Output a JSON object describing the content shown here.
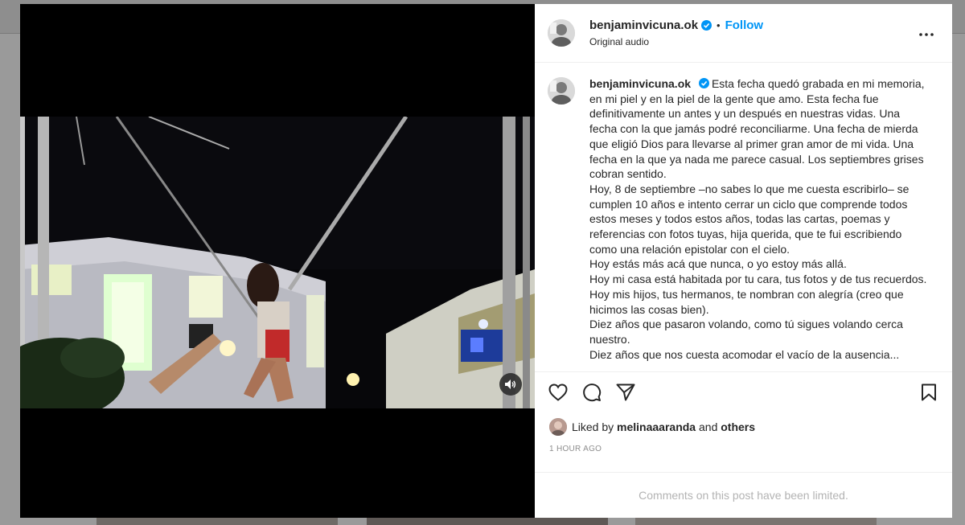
{
  "post": {
    "username": "benjaminvicuna.ok",
    "follow_label": "Follow",
    "separator": "•",
    "audio_label": "Original audio",
    "more_icon": "more-horizontal-icon"
  },
  "caption": {
    "username": "benjaminvicuna.ok",
    "paragraphs": [
      "Esta fecha quedó grabada en mi memoria, en mi piel y en la piel de la gente que amo. Esta fecha fue definitivamente un antes y un después en nuestras vidas. Una fecha con la que jamás podré reconciliarme. Una fecha de mierda que eligió Dios para llevarse al primer gran amor de mi vida. Una fecha en la que ya nada me parece casual. Los septiembres grises cobran sentido.",
      "Hoy, 8 de septiembre –no sabes lo que me cuesta escribirlo– se cumplen 10 años e intento cerrar un ciclo que comprende todos estos meses y todos estos años, todas las cartas, poemas y referencias con fotos tuyas, hija querida, que te fui escribiendo como una relación epistolar con el cielo.",
      "Hoy estás más acá que nunca, o yo estoy más allá.",
      "Hoy mi casa está habitada por tu cara, tus fotos y de tus recuerdos.",
      "Hoy mis hijos, tus hermanos, te nombran con alegría (creo que hicimos las cosas bien).",
      "Diez años que pasaron volando, como tú sigues volando cerca nuestro.",
      "Diez años que nos cuesta acomodar el vacío de la ausencia..."
    ]
  },
  "actions": {
    "like_icon": "heart-icon",
    "comment_icon": "comment-icon",
    "share_icon": "send-icon",
    "save_icon": "bookmark-icon"
  },
  "likes": {
    "prefix": "Liked by",
    "user": "melinaaaranda",
    "conjunction": "and",
    "others": "others"
  },
  "timestamp": "1 HOUR AGO",
  "comments_notice": "Comments on this post have been limited.",
  "video": {
    "mute_icon": "speaker-icon"
  },
  "colors": {
    "accent": "#0095f6",
    "text": "#262626",
    "muted": "#8e8e8e",
    "overlay": "#9a9a9a"
  }
}
